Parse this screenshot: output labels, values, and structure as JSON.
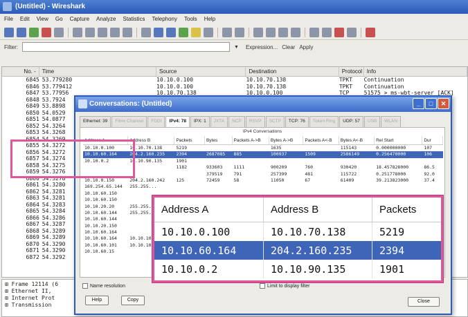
{
  "wireshark": {
    "title": "(Untitled) - Wireshark",
    "menu": [
      "File",
      "Edit",
      "View",
      "Go",
      "Capture",
      "Analyze",
      "Statistics",
      "Telephony",
      "Tools",
      "Help"
    ],
    "filter_label": "Filter:",
    "expression_label": "Expression...",
    "clear_label": "Clear",
    "apply_label": "Apply",
    "columns": [
      "No. -",
      "Time",
      "Source",
      "Destination",
      "Protocol",
      "Info"
    ],
    "packets": [
      {
        "no": "6845",
        "time": "53.779280",
        "src": "10.10.0.100",
        "dst": "10.10.70.138",
        "proto": "TPKT",
        "info": "Continuation"
      },
      {
        "no": "6846",
        "time": "53.779412",
        "src": "10.10.0.100",
        "dst": "10.10.70.138",
        "proto": "TPKT",
        "info": "Continuation"
      },
      {
        "no": "6847",
        "time": "53.77956",
        "src": "10.10.70.138",
        "dst": "10.10.0.100",
        "proto": "TCP",
        "info": "51575 > ms-wbt-server [ACK]"
      },
      {
        "no": "6848",
        "time": "53.7924",
        "src": "",
        "dst": "",
        "proto": "",
        "info": ""
      },
      {
        "no": "6849",
        "time": "53.8898",
        "src": "",
        "dst": "",
        "proto": "",
        "info": ""
      },
      {
        "no": "6850",
        "time": "54.0529",
        "src": "",
        "dst": "",
        "proto": "",
        "info": ""
      },
      {
        "no": "6851",
        "time": "54.0877",
        "src": "",
        "dst": "",
        "proto": "",
        "info": ""
      },
      {
        "no": "6852",
        "time": "54.3264",
        "src": "",
        "dst": "",
        "proto": "",
        "info": ""
      },
      {
        "no": "6853",
        "time": "54.3268",
        "src": "",
        "dst": "",
        "proto": "",
        "info": ""
      },
      {
        "no": "6854",
        "time": "54.3269",
        "src": "",
        "dst": "",
        "proto": "",
        "info": ""
      },
      {
        "no": "6855",
        "time": "54.3272",
        "src": "",
        "dst": "",
        "proto": "",
        "info": ""
      },
      {
        "no": "6856",
        "time": "54.3272",
        "src": "",
        "dst": "",
        "proto": "",
        "info": ""
      },
      {
        "no": "6857",
        "time": "54.3274",
        "src": "",
        "dst": "",
        "proto": "",
        "info": ""
      },
      {
        "no": "6858",
        "time": "54.3275",
        "src": "",
        "dst": "",
        "proto": "",
        "info": ""
      },
      {
        "no": "6859",
        "time": "54.3276",
        "src": "",
        "dst": "",
        "proto": "",
        "info": ""
      },
      {
        "no": "6860",
        "time": "54.3278",
        "src": "",
        "dst": "",
        "proto": "",
        "info": ""
      },
      {
        "no": "6861",
        "time": "54.3280",
        "src": "",
        "dst": "",
        "proto": "",
        "info": ""
      },
      {
        "no": "6862",
        "time": "54.3281",
        "src": "",
        "dst": "",
        "proto": "",
        "info": ""
      },
      {
        "no": "6863",
        "time": "54.3281",
        "src": "",
        "dst": "",
        "proto": "",
        "info": ""
      },
      {
        "no": "6864",
        "time": "54.3283",
        "src": "",
        "dst": "",
        "proto": "",
        "info": ""
      },
      {
        "no": "6865",
        "time": "54.3284",
        "src": "",
        "dst": "",
        "proto": "",
        "info": ""
      },
      {
        "no": "6866",
        "time": "54.3286",
        "src": "",
        "dst": "",
        "proto": "",
        "info": ""
      },
      {
        "no": "6867",
        "time": "54.3287",
        "src": "",
        "dst": "",
        "proto": "",
        "info": ""
      },
      {
        "no": "6868",
        "time": "54.3289",
        "src": "",
        "dst": "",
        "proto": "",
        "info": ""
      },
      {
        "no": "6869",
        "time": "54.3289",
        "src": "",
        "dst": "",
        "proto": "",
        "info": ""
      },
      {
        "no": "6870",
        "time": "54.3290",
        "src": "",
        "dst": "",
        "proto": "",
        "info": ""
      },
      {
        "no": "6871",
        "time": "54.3290",
        "src": "",
        "dst": "",
        "proto": "",
        "info": ""
      },
      {
        "no": "6872",
        "time": "54.3292",
        "src": "",
        "dst": "",
        "proto": "",
        "info": ""
      }
    ],
    "details": [
      "⊞ Frame 12114 (6",
      "⊞ Ethernet II,",
      "⊞ Internet Prot",
      "⊞ Transmission"
    ]
  },
  "dialog": {
    "title": "Conversations: (Untitled)",
    "tabs": [
      {
        "label": "Ethernet: 39",
        "state": "on"
      },
      {
        "label": "Fibre Channel",
        "state": "off"
      },
      {
        "label": "FDDI",
        "state": "off"
      },
      {
        "label": "IPv4: 78",
        "state": "active"
      },
      {
        "label": "IPX: 1",
        "state": "on"
      },
      {
        "label": "JXTA",
        "state": "off"
      },
      {
        "label": "NCP",
        "state": "off"
      },
      {
        "label": "RSVP",
        "state": "off"
      },
      {
        "label": "SCTP",
        "state": "off"
      },
      {
        "label": "TCP: 76",
        "state": "on"
      },
      {
        "label": "Token Ring",
        "state": "off"
      },
      {
        "label": "UDP: 57",
        "state": "on"
      },
      {
        "label": "USB",
        "state": "off"
      },
      {
        "label": "WLAN",
        "state": "off"
      }
    ],
    "panel_title": "IPv4 Conversations",
    "columns": [
      "Address A",
      "Address B",
      "Packets",
      "Bytes",
      "Packets A->B",
      "Bytes A->B",
      "Packets A<-B",
      "Bytes A<-B",
      "Rel Start",
      "Dur"
    ],
    "rows": [
      {
        "a": "10.10.0.100",
        "b": "10.10.70.138",
        "p": "5219",
        "by": "",
        "pab": "",
        "bab": "1635",
        "pba": "",
        "bba": "115143",
        "rs": "0.000000000",
        "du": "107"
      },
      {
        "a": "10.10.60.164",
        "b": "204.2.160.235",
        "p": "2394",
        "by": "2687085",
        "pab": "885",
        "bab": "100937",
        "pba": "1509",
        "bba": "2586149",
        "rs": "0.256470000",
        "du": "106"
      },
      {
        "a": "10.10.0.2",
        "b": "10.10.90.135",
        "p": "1901",
        "by": "",
        "pab": "",
        "bab": "",
        "pba": "",
        "bba": "",
        "rs": "",
        "du": ""
      },
      {
        "a": "",
        "b": "",
        "p": "1182",
        "by": "933603",
        "pab": "1111",
        "bab": "900209",
        "pba": "760",
        "bba": "930420",
        "rs": "18.457828000",
        "du": "86.5"
      },
      {
        "a": "",
        "b": "",
        "p": "",
        "by": "379519",
        "pab": "791",
        "bab": "257399",
        "pba": "481",
        "bba": "115722",
        "rs": "0.251778000",
        "du": "92.0"
      },
      {
        "a": "10.10.0.150",
        "b": "204.2.160.242",
        "p": "125",
        "by": "72459",
        "pab": "58",
        "bab": "11050",
        "pba": "67",
        "bba": "61409",
        "rs": "39.213823000",
        "du": "37.4"
      },
      {
        "a": "169.254.65.144",
        "b": "255.255...",
        "p": "",
        "by": "",
        "pab": "",
        "bab": "",
        "pba": "",
        "bba": "",
        "rs": "",
        "du": ""
      },
      {
        "a": "10.10.60.150",
        "b": "",
        "p": "",
        "by": "",
        "pab": "",
        "bab": "",
        "pba": "",
        "bba": "",
        "rs": "",
        "du": ""
      },
      {
        "a": "10.10.60.150",
        "b": "",
        "p": "",
        "by": "",
        "pab": "",
        "bab": "",
        "pba": "",
        "bba": "",
        "rs": "",
        "du": ""
      },
      {
        "a": "10.10.20.20",
        "b": "255.255...",
        "p": "",
        "by": "",
        "pab": "",
        "bab": "",
        "pba": "",
        "bba": "",
        "rs": "",
        "du": ""
      },
      {
        "a": "10.10.60.144",
        "b": "255.255...",
        "p": "",
        "by": "",
        "pab": "",
        "bab": "",
        "pba": "",
        "bba": "",
        "rs": "",
        "du": ""
      },
      {
        "a": "10.10.60.144",
        "b": "",
        "p": "",
        "by": "",
        "pab": "",
        "bab": "",
        "pba": "",
        "bba": "",
        "rs": "",
        "du": ""
      },
      {
        "a": "10.10.20.150",
        "b": "",
        "p": "",
        "by": "",
        "pab": "",
        "bab": "",
        "pba": "",
        "bba": "",
        "rs": "",
        "du": ""
      },
      {
        "a": "10.10.60.164",
        "b": "",
        "p": "",
        "by": "",
        "pab": "",
        "bab": "",
        "pba": "",
        "bba": "",
        "rs": "",
        "du": ""
      },
      {
        "a": "10.10.60.164",
        "b": "10.10.10...",
        "p": "",
        "by": "",
        "pab": "",
        "bab": "",
        "pba": "",
        "bba": "",
        "rs": "",
        "du": ""
      },
      {
        "a": "10.10.60.101",
        "b": "10.10.10...",
        "p": "",
        "by": "",
        "pab": "",
        "bab": "",
        "pba": "",
        "bba": "",
        "rs": "",
        "du": ""
      },
      {
        "a": "10.10.60.15",
        "b": "",
        "p": "",
        "by": "",
        "pab": "",
        "bab": "",
        "pba": "",
        "bba": "",
        "rs": "",
        "du": ""
      }
    ],
    "name_resolution_label": "Name resolution",
    "limit_label": "Limit to display filter",
    "help_label": "Help",
    "copy_label": "Copy",
    "close_label": "Close"
  },
  "zoom": {
    "columns": [
      "Address A",
      "Address B",
      "Packets"
    ],
    "rows": [
      {
        "a": "10.10.0.100",
        "b": "10.10.70.138",
        "p": "5219"
      },
      {
        "a": "10.10.60.164",
        "b": "204.2.160.235",
        "p": "2394"
      },
      {
        "a": "10.10.0.2",
        "b": "10.10.90.135",
        "p": "1901"
      }
    ]
  },
  "colors": {
    "selection": "#3f65b8",
    "highlight": "#e0569a",
    "titlebar": "#2a5cb8"
  }
}
